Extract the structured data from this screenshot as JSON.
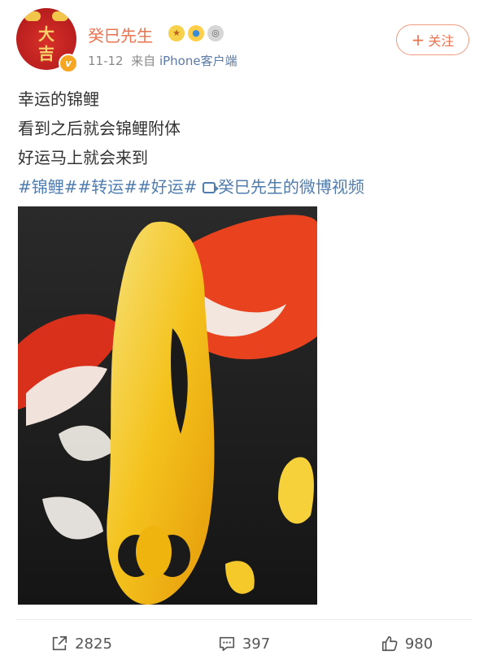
{
  "user": {
    "avatar_text_top": "大",
    "avatar_text_bottom": "吉",
    "verified_badge": "v",
    "name": "癸巳先生",
    "badges": [
      "trophy-icon",
      "fan-badge-icon",
      "medal-icon"
    ]
  },
  "post_meta": {
    "date": "11-12",
    "source_prefix": "来自",
    "source": "iPhone客户端"
  },
  "follow_button": {
    "plus": "+",
    "label": "关注"
  },
  "content": {
    "lines": [
      "幸运的锦鲤",
      "看到之后就会锦鲤附体",
      "好运马上就会来到"
    ],
    "tags": [
      "#锦鲤#",
      "#转运#",
      "#好运#"
    ],
    "video_link": "癸巳先生的微博视频"
  },
  "media": {
    "type": "video-thumbnail",
    "subject": "koi-fish-icon"
  },
  "actions": {
    "repost": {
      "icon": "repost-icon",
      "count": "2825"
    },
    "comment": {
      "icon": "comment-icon",
      "count": "397"
    },
    "like": {
      "icon": "like-icon",
      "count": "980"
    }
  },
  "colors": {
    "username": "#eb7350",
    "link": "#507daf",
    "meta": "#8a8a8a"
  }
}
